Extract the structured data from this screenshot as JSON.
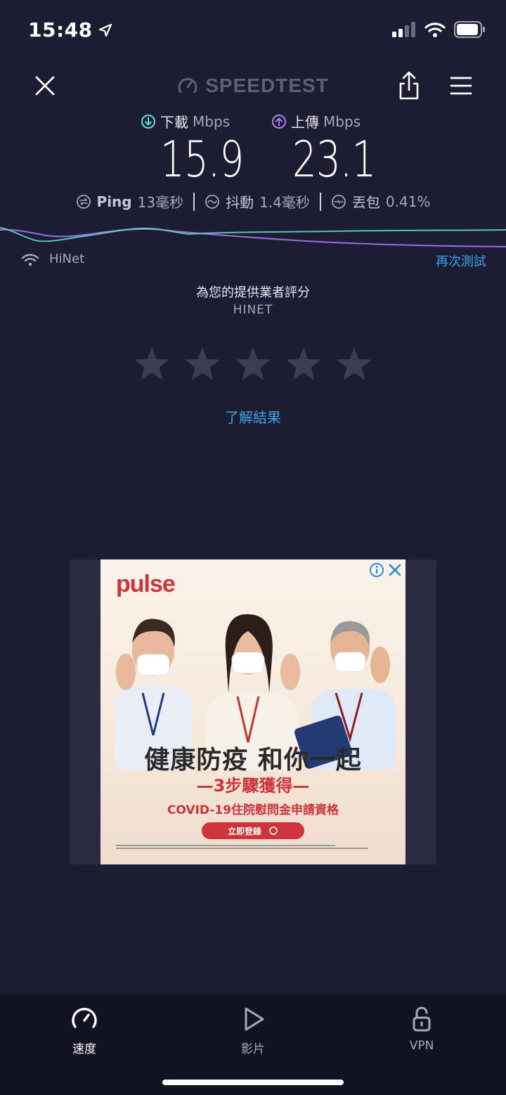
{
  "status_bar": {
    "time": "15:48"
  },
  "header": {
    "logo": "SPEEDTEST",
    "icons": [
      "close-icon",
      "speedometer-icon",
      "share-icon",
      "menu-icon"
    ]
  },
  "download": {
    "label": "下載",
    "unit": "Mbps",
    "value": "15.9"
  },
  "upload": {
    "label": "上傳",
    "unit": "Mbps",
    "value": "23.1"
  },
  "metrics": {
    "ping": {
      "label": "Ping",
      "value": "13毫秒"
    },
    "jitter": {
      "label": "抖動",
      "value": "1.4毫秒"
    },
    "loss": {
      "label": "丟包",
      "value": "0.41%"
    }
  },
  "connection": {
    "isp": "HiNet",
    "retest_label": "再次測試"
  },
  "rating": {
    "title": "為您的提供業者評分",
    "provider": "HINET",
    "stars_total": 5,
    "stars_filled": 0
  },
  "learn_results_label": "了解結果",
  "ad": {
    "brand": "pulse",
    "headline": "健康防疫 和你一起",
    "sub": "—3步驟獲得—",
    "line3": "COVID-19住院慰問金申請資格",
    "cta": "立即登錄"
  },
  "tabs": [
    {
      "label": "速度",
      "icon": "speedometer-icon",
      "active": true
    },
    {
      "label": "影片",
      "icon": "play-icon",
      "active": false
    },
    {
      "label": "VPN",
      "icon": "lock-icon",
      "active": false
    }
  ],
  "colors": {
    "background": "#1c1d33",
    "download": "#5ee0d0",
    "upload": "#b07cf0",
    "link": "#3aa2e8",
    "ad_red": "#d0343a"
  }
}
